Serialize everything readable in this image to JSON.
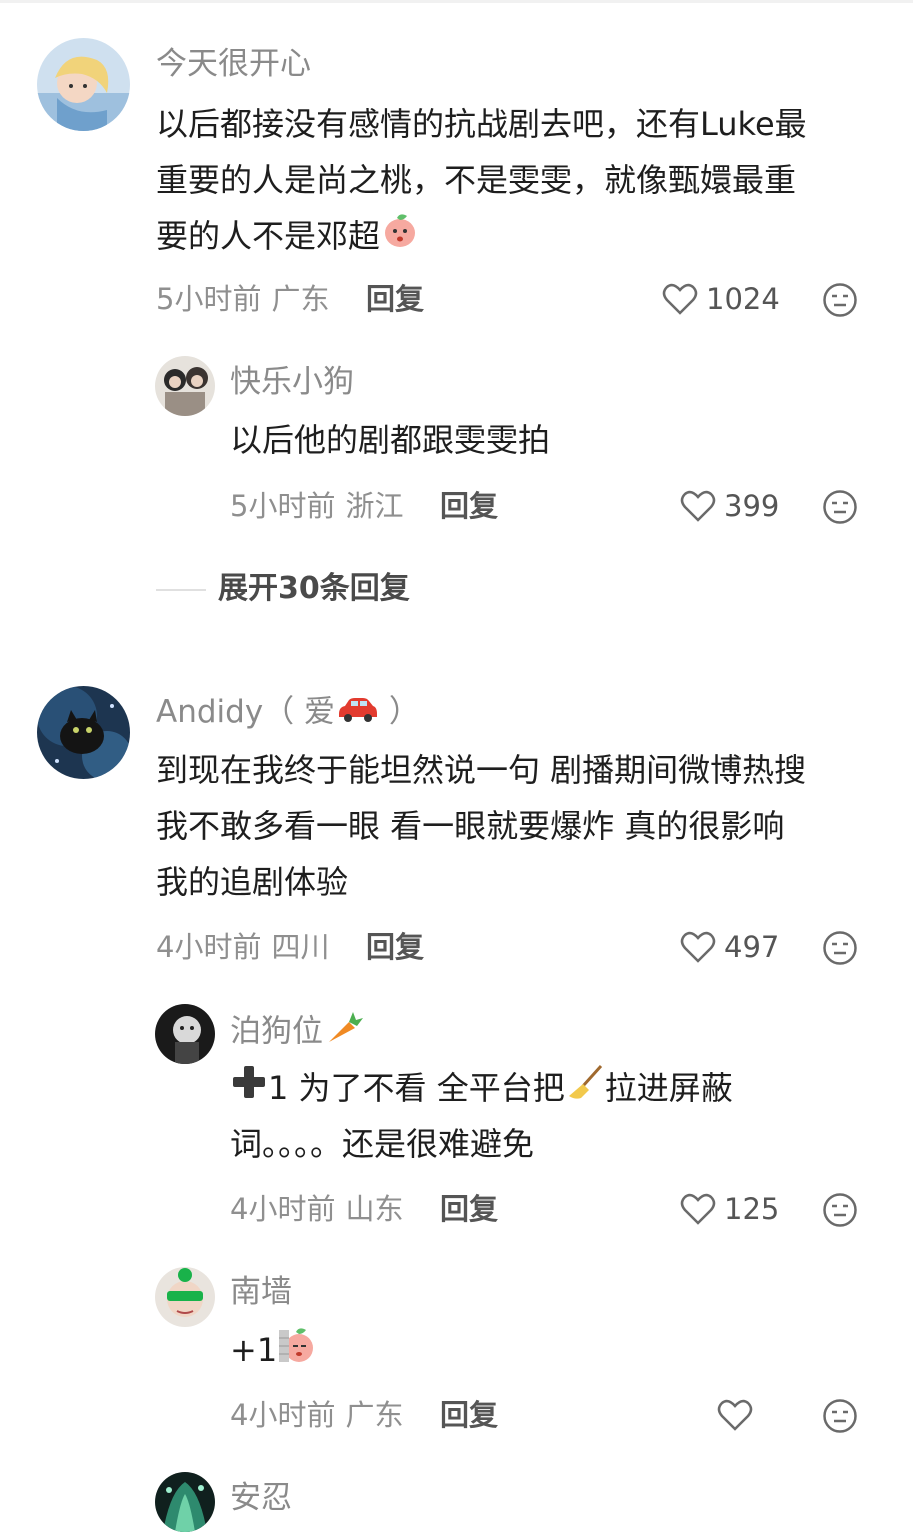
{
  "comments": [
    {
      "author": "今天很开心",
      "lines": [
        "以后都接没有感情的抗战剧去吧，还有Luke最",
        "重要的人是尚之桃，不是雯雯，就像甄嬛最重",
        "要的人不是邓超"
      ],
      "time": "5小时前",
      "location": "广东",
      "reply_label": "回复",
      "likes": "1024",
      "replies": [
        {
          "author": "快乐小狗",
          "lines": [
            "以后他的剧都跟雯雯拍"
          ],
          "time": "5小时前",
          "location": "浙江",
          "reply_label": "回复",
          "likes": "399"
        }
      ],
      "expand_label": "展开30条回复"
    },
    {
      "author": "Andidy",
      "author_suffix_open": "（ 爱",
      "author_suffix_close": " ）",
      "lines": [
        "到现在我终于能坦然说一句 剧播期间微博热搜",
        "我不敢多看一眼 看一眼就要爆炸 真的很影响",
        "我的追剧体验"
      ],
      "time": "4小时前",
      "location": "四川",
      "reply_label": "回复",
      "likes": "497",
      "replies": [
        {
          "author": "泊狗位",
          "lines_a": "1 为了不看 全平台把",
          "lines_b": "拉进屏蔽",
          "lines_c": "词。。。。还是很难避免",
          "time": "4小时前",
          "location": "山东",
          "reply_label": "回复",
          "likes": "125"
        },
        {
          "author": "南墙",
          "text": "+1",
          "time": "4小时前",
          "location": "广东",
          "reply_label": "回复",
          "likes": ""
        },
        {
          "author": "安忍"
        }
      ]
    }
  ],
  "icons": {
    "like": "heart-outline-icon",
    "dislike": "neutral-face-icon",
    "emoji_peach": "peach-emoji",
    "emoji_car": "red-car-emoji",
    "emoji_carrot": "carrot-emoji",
    "emoji_plus": "heavy-plus-emoji",
    "emoji_broom": "broom-emoji"
  }
}
